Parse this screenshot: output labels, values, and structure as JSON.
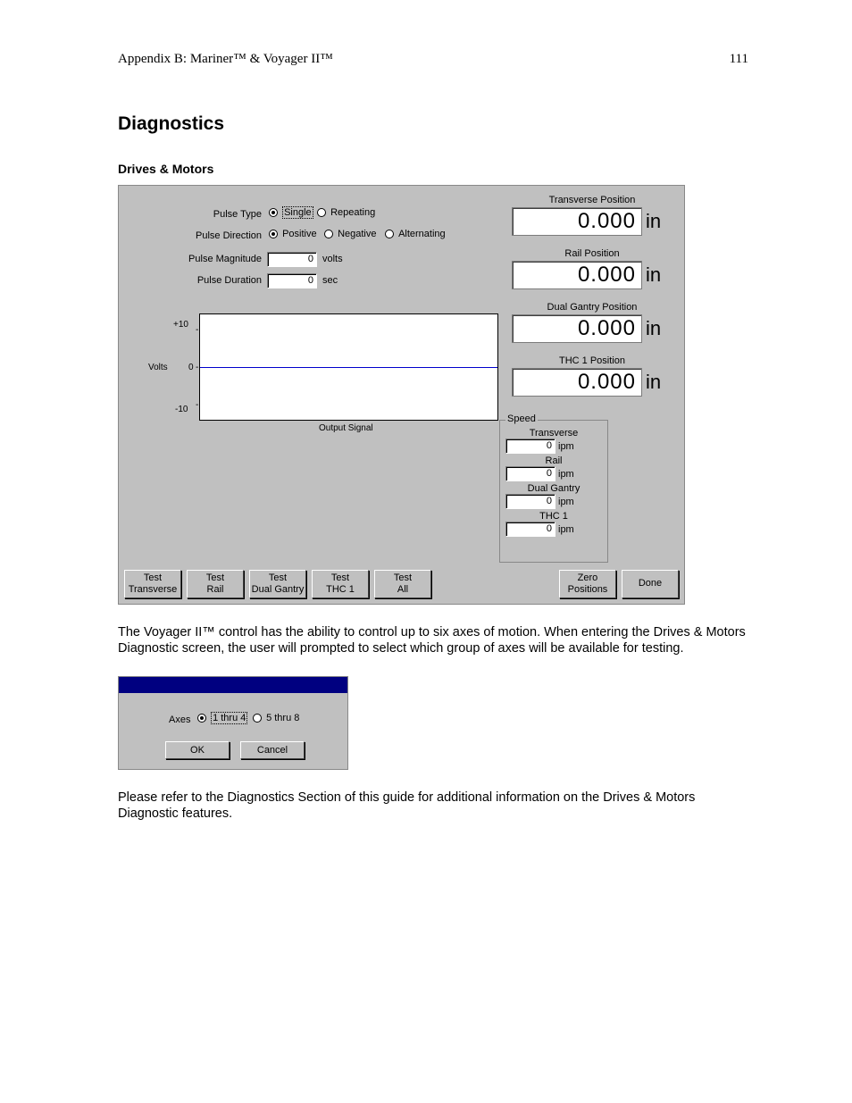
{
  "header": {
    "left": "Appendix B: Mariner™ & Voyager II™",
    "right": "111"
  },
  "h1": "Diagnostics",
  "h2": "Drives & Motors",
  "pulse": {
    "type_label": "Pulse Type",
    "type_opts": {
      "single": "Single",
      "repeating": "Repeating"
    },
    "dir_label": "Pulse Direction",
    "dir_opts": {
      "positive": "Positive",
      "negative": "Negative",
      "alternating": "Alternating"
    },
    "mag_label": "Pulse Magnitude",
    "mag_value": "0",
    "mag_unit": "volts",
    "dur_label": "Pulse Duration",
    "dur_value": "0",
    "dur_unit": "sec"
  },
  "chart": {
    "ylabel": "Volts",
    "ticks": {
      "p10": "+10",
      "zero": "0",
      "n10": "-10"
    },
    "xlabel": "Output Signal"
  },
  "chart_data": {
    "type": "line",
    "x": [
      0,
      1
    ],
    "series": [
      {
        "name": "Output Signal",
        "values": [
          0,
          0
        ]
      }
    ],
    "ylabel": "Volts",
    "xlabel": "Output Signal",
    "ylim": [
      -10,
      10
    ]
  },
  "positions": {
    "transverse": {
      "label": "Transverse Position",
      "value": "0.000",
      "unit": "in"
    },
    "rail": {
      "label": "Rail Position",
      "value": "0.000",
      "unit": "in"
    },
    "dual": {
      "label": "Dual Gantry Position",
      "value": "0.000",
      "unit": "in"
    },
    "thc1": {
      "label": "THC 1 Position",
      "value": "0.000",
      "unit": "in"
    }
  },
  "speed": {
    "legend": "Speed",
    "transverse": {
      "label": "Transverse",
      "value": "0",
      "unit": "ipm"
    },
    "rail": {
      "label": "Rail",
      "value": "0",
      "unit": "ipm"
    },
    "dual": {
      "label": "Dual Gantry",
      "value": "0",
      "unit": "ipm"
    },
    "thc1": {
      "label": "THC 1",
      "value": "0",
      "unit": "ipm"
    }
  },
  "buttons": {
    "test_transverse": "Test\nTransverse",
    "test_rail": "Test\nRail",
    "test_dual": "Test\nDual Gantry",
    "test_thc1": "Test\nTHC 1",
    "test_all": "Test\nAll",
    "zero": "Zero\nPositions",
    "done": "Done"
  },
  "para1": "The Voyager II™ control has the ability to control up to six axes of motion.  When entering the Drives & Motors Diagnostic screen, the user will prompted to select which group of axes will be available for testing.",
  "dialog": {
    "axes_label": "Axes",
    "opt1": "1 thru 4",
    "opt2": "5 thru 8",
    "ok": "OK",
    "cancel": "Cancel"
  },
  "para2": "Please refer to the Diagnostics Section of this guide for additional information on the Drives & Motors Diagnostic features."
}
